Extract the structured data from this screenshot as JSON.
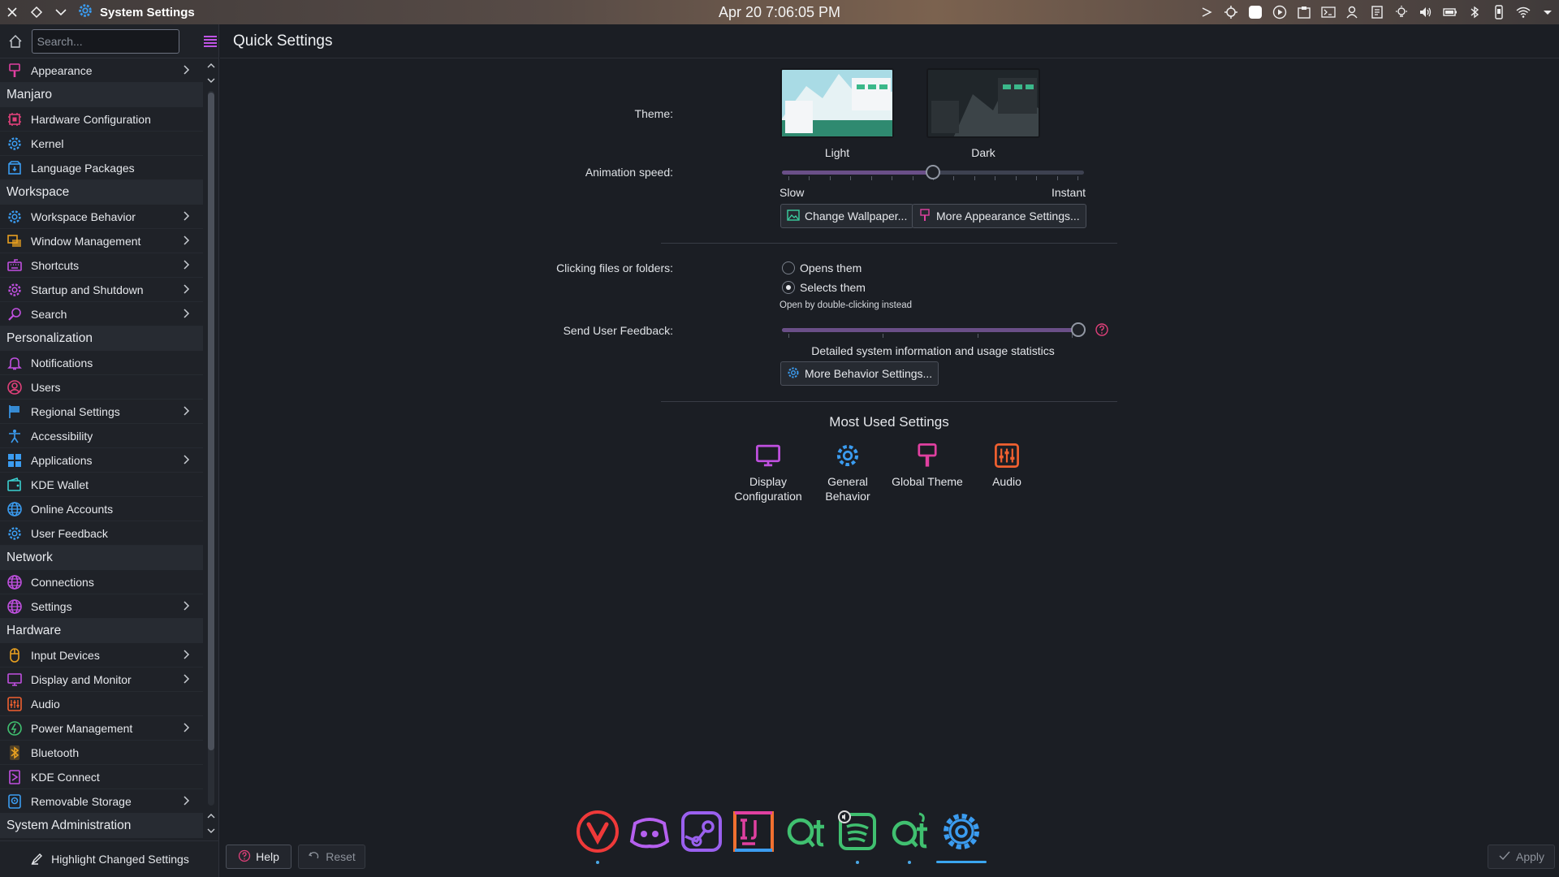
{
  "window": {
    "title": "System Settings",
    "clock": "Apr 20 7:06:05 PM"
  },
  "sidebar": {
    "search_placeholder": "Search...",
    "footer_label": "Highlight Changed Settings",
    "entries": [
      {
        "kind": "item",
        "label": "Appearance",
        "icon": "paintbrush-icon",
        "color": "#e040a0",
        "arrow": true
      },
      {
        "kind": "cat",
        "label": "Manjaro"
      },
      {
        "kind": "item",
        "label": "Hardware Configuration",
        "icon": "chip-icon",
        "color": "#e0407a",
        "arrow": false
      },
      {
        "kind": "item",
        "label": "Kernel",
        "icon": "gear-icon",
        "color": "#3b9cf0",
        "arrow": false
      },
      {
        "kind": "item",
        "label": "Language Packages",
        "icon": "package-icon",
        "color": "#3b9cf0",
        "arrow": false
      },
      {
        "kind": "cat",
        "label": "Workspace"
      },
      {
        "kind": "item",
        "label": "Workspace Behavior",
        "icon": "gear-icon",
        "color": "#3b9cf0",
        "arrow": true
      },
      {
        "kind": "item",
        "label": "Window Management",
        "icon": "windows-icon",
        "color": "#e8a020",
        "arrow": true
      },
      {
        "kind": "item",
        "label": "Shortcuts",
        "icon": "keyboard-icon",
        "color": "#c050e0",
        "arrow": true
      },
      {
        "kind": "item",
        "label": "Startup and Shutdown",
        "icon": "gear-icon",
        "color": "#c050e0",
        "arrow": true
      },
      {
        "kind": "item",
        "label": "Search",
        "icon": "magnifier-icon",
        "color": "#c050e0",
        "arrow": true
      },
      {
        "kind": "cat",
        "label": "Personalization"
      },
      {
        "kind": "item",
        "label": "Notifications",
        "icon": "bell-icon",
        "color": "#c050e0",
        "arrow": false
      },
      {
        "kind": "item",
        "label": "Users",
        "icon": "user-icon",
        "color": "#e0407a",
        "arrow": false
      },
      {
        "kind": "item",
        "label": "Regional Settings",
        "icon": "flag-icon",
        "color": "#3b9cf0",
        "arrow": true
      },
      {
        "kind": "item",
        "label": "Accessibility",
        "icon": "accessibility-icon",
        "color": "#3b9cf0",
        "arrow": false
      },
      {
        "kind": "item",
        "label": "Applications",
        "icon": "grid-icon",
        "color": "#3b9cf0",
        "arrow": true
      },
      {
        "kind": "item",
        "label": "KDE Wallet",
        "icon": "wallet-icon",
        "color": "#3bd0d0",
        "arrow": false
      },
      {
        "kind": "item",
        "label": "Online Accounts",
        "icon": "globe-icon",
        "color": "#3b9cf0",
        "arrow": false
      },
      {
        "kind": "item",
        "label": "User Feedback",
        "icon": "gear-icon",
        "color": "#3b9cf0",
        "arrow": false
      },
      {
        "kind": "cat",
        "label": "Network"
      },
      {
        "kind": "item",
        "label": "Connections",
        "icon": "globe-icon",
        "color": "#c050e0",
        "arrow": false
      },
      {
        "kind": "item",
        "label": "Settings",
        "icon": "globe-icon",
        "color": "#c050e0",
        "arrow": true
      },
      {
        "kind": "cat",
        "label": "Hardware"
      },
      {
        "kind": "item",
        "label": "Input Devices",
        "icon": "mouse-icon",
        "color": "#e8a020",
        "arrow": true
      },
      {
        "kind": "item",
        "label": "Display and Monitor",
        "icon": "monitor-icon",
        "color": "#c050e0",
        "arrow": true
      },
      {
        "kind": "item",
        "label": "Audio",
        "icon": "mixer-icon",
        "color": "#f06030",
        "arrow": false
      },
      {
        "kind": "item",
        "label": "Power Management",
        "icon": "power-icon",
        "color": "#40c070",
        "arrow": true
      },
      {
        "kind": "item",
        "label": "Bluetooth",
        "icon": "bluetooth-icon",
        "color": "#e8a020",
        "arrow": false
      },
      {
        "kind": "item",
        "label": "KDE Connect",
        "icon": "phone-icon",
        "color": "#c050e0",
        "arrow": false
      },
      {
        "kind": "item",
        "label": "Removable Storage",
        "icon": "drive-icon",
        "color": "#3b9cf0",
        "arrow": true
      },
      {
        "kind": "cat",
        "label": "System Administration"
      }
    ]
  },
  "main": {
    "title": "Quick Settings",
    "theme": {
      "label": "Theme:",
      "options": [
        {
          "name": "Light"
        },
        {
          "name": "Dark"
        }
      ]
    },
    "animation": {
      "label": "Animation speed:",
      "min_label": "Slow",
      "max_label": "Instant",
      "value": 0.5
    },
    "buttons": {
      "wallpaper": "Change Wallpaper...",
      "appearance": "More Appearance Settings...",
      "behavior": "More Behavior Settings..."
    },
    "clicking": {
      "label": "Clicking files or folders:",
      "opt1": "Opens them",
      "opt2": "Selects them",
      "hint": "Open by double-clicking instead",
      "selected": "Selects them"
    },
    "feedback": {
      "label": "Send User Feedback:",
      "description": "Detailed system information and usage statistics",
      "value": 1.0
    },
    "most_used": {
      "title": "Most Used Settings",
      "items": [
        {
          "line1": "Display",
          "line2": "Configuration",
          "icon": "monitor-icon",
          "color": "#c050e0"
        },
        {
          "line1": "General",
          "line2": "Behavior",
          "icon": "gear-icon",
          "color": "#3b9cf0"
        },
        {
          "line1": "Global Theme",
          "line2": "",
          "icon": "paintbrush-icon",
          "color": "#e040a0"
        },
        {
          "line1": "Audio",
          "line2": "",
          "icon": "mixer-icon",
          "color": "#f06030"
        }
      ]
    }
  },
  "bottom": {
    "help": "Help",
    "reset": "Reset",
    "apply": "Apply"
  },
  "dock": [
    {
      "name": "vivaldi-icon",
      "color": "#ef3939",
      "running": true
    },
    {
      "name": "discord-icon",
      "color": "#b560ef",
      "running": false
    },
    {
      "name": "steam-icon",
      "color": "#9a60ef",
      "running": false
    },
    {
      "name": "intellij-icon",
      "color": "#e040a0",
      "running": false
    },
    {
      "name": "qt-icon",
      "color": "#40c070",
      "running": false
    },
    {
      "name": "spotify-icon",
      "color": "#40c070",
      "running": true
    },
    {
      "name": "qt-designer-icon",
      "color": "#40c070",
      "running": true
    },
    {
      "name": "system-settings-icon",
      "color": "#3b9cf0",
      "active": true
    }
  ]
}
